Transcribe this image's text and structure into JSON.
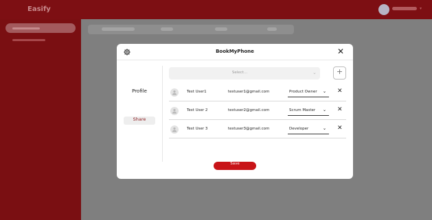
{
  "app": {
    "logo": "Easify"
  },
  "modal": {
    "title": "BookMyPhone",
    "close_label": "✕",
    "nav": {
      "profile": "Profile",
      "share": "Share"
    },
    "select": {
      "placeholder": "Select...",
      "chevron": "⌄"
    },
    "add_label": "+",
    "rows": [
      {
        "name": "Test User1",
        "email": "testuser1@gmail.com",
        "role": "Product Owner"
      },
      {
        "name": "Test User 2",
        "email": "testuser2@gmail.com",
        "role": "Scrum Master"
      },
      {
        "name": "Test User 3",
        "email": "testuser3@gmail.com",
        "role": "Developer"
      }
    ],
    "role_chevron": "⌄",
    "remove_label": "✕",
    "save_label": "Save"
  },
  "colors": {
    "brand": "#7d0f13",
    "accent": "#c81418",
    "overlay": "#7f7f7f"
  },
  "icons": {
    "settings": "gear-icon",
    "close": "close-icon",
    "avatar": "user-avatar-icon",
    "add": "plus-icon"
  }
}
